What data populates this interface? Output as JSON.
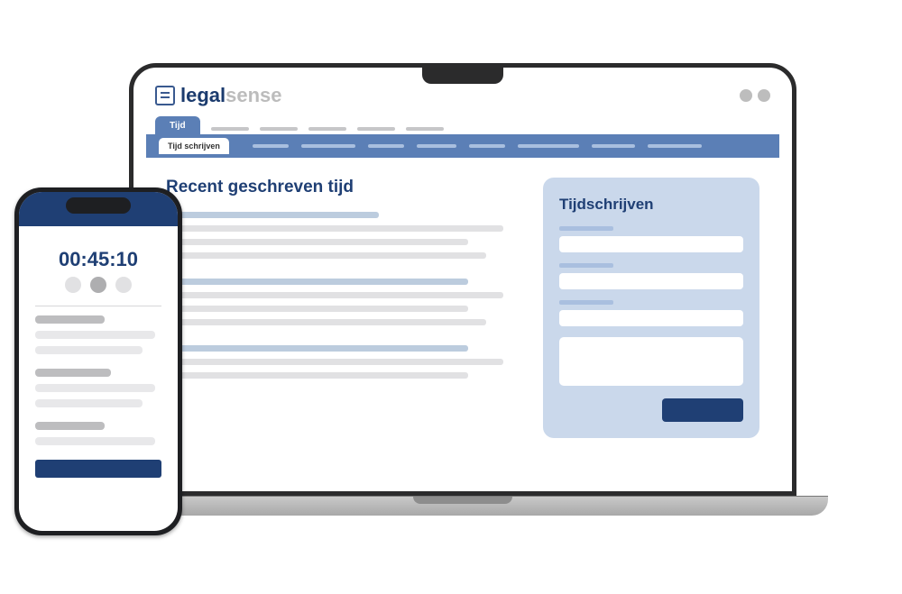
{
  "brand": {
    "name_strong": "legal",
    "name_light": "sense"
  },
  "laptop": {
    "tabs": {
      "active_label": "Tijd"
    },
    "subtab": {
      "label": "Tijd schrijven"
    },
    "main": {
      "recent_title": "Recent geschreven tijd",
      "form_title": "Tijdschrijven"
    }
  },
  "phone": {
    "timer": "00:45:10"
  }
}
